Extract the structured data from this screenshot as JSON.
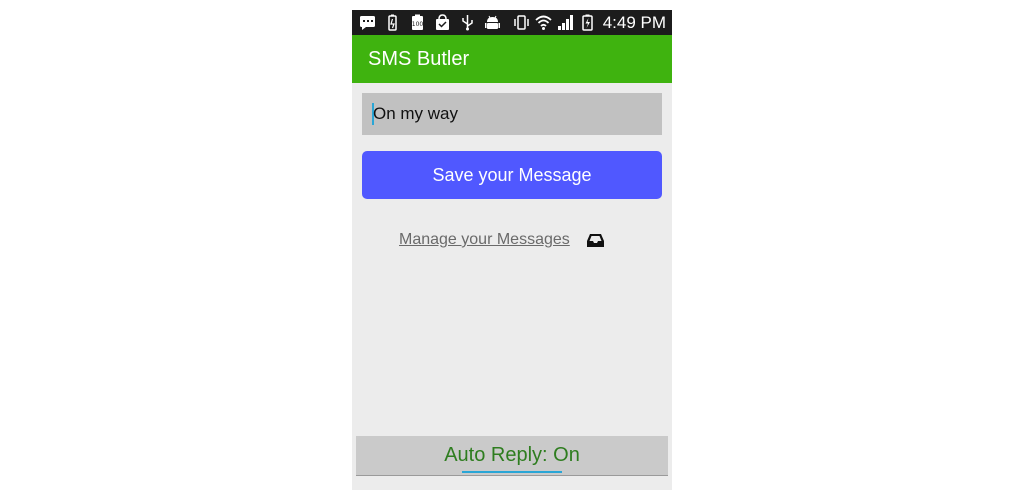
{
  "status_bar": {
    "time": "4:49 PM",
    "icons": [
      "chat-icon",
      "battery-saver-icon",
      "battery-100-icon",
      "shopping-bag-icon",
      "usb-icon",
      "android-debug-icon",
      "vibrate-icon",
      "wifi-icon",
      "signal-icon",
      "battery-charging-icon"
    ]
  },
  "app_bar": {
    "title": "SMS Butler"
  },
  "message_input": {
    "value": "On my way"
  },
  "save_button": {
    "label": "Save your Message"
  },
  "manage": {
    "label": "Manage your Messages",
    "icon": "inbox-icon"
  },
  "auto_reply": {
    "label": "Auto Reply: On"
  },
  "colors": {
    "app_bar": "#3fb30f",
    "save_button": "#5058ff",
    "auto_reply_text": "#2e7d1f",
    "accent": "#2aa6d6"
  }
}
